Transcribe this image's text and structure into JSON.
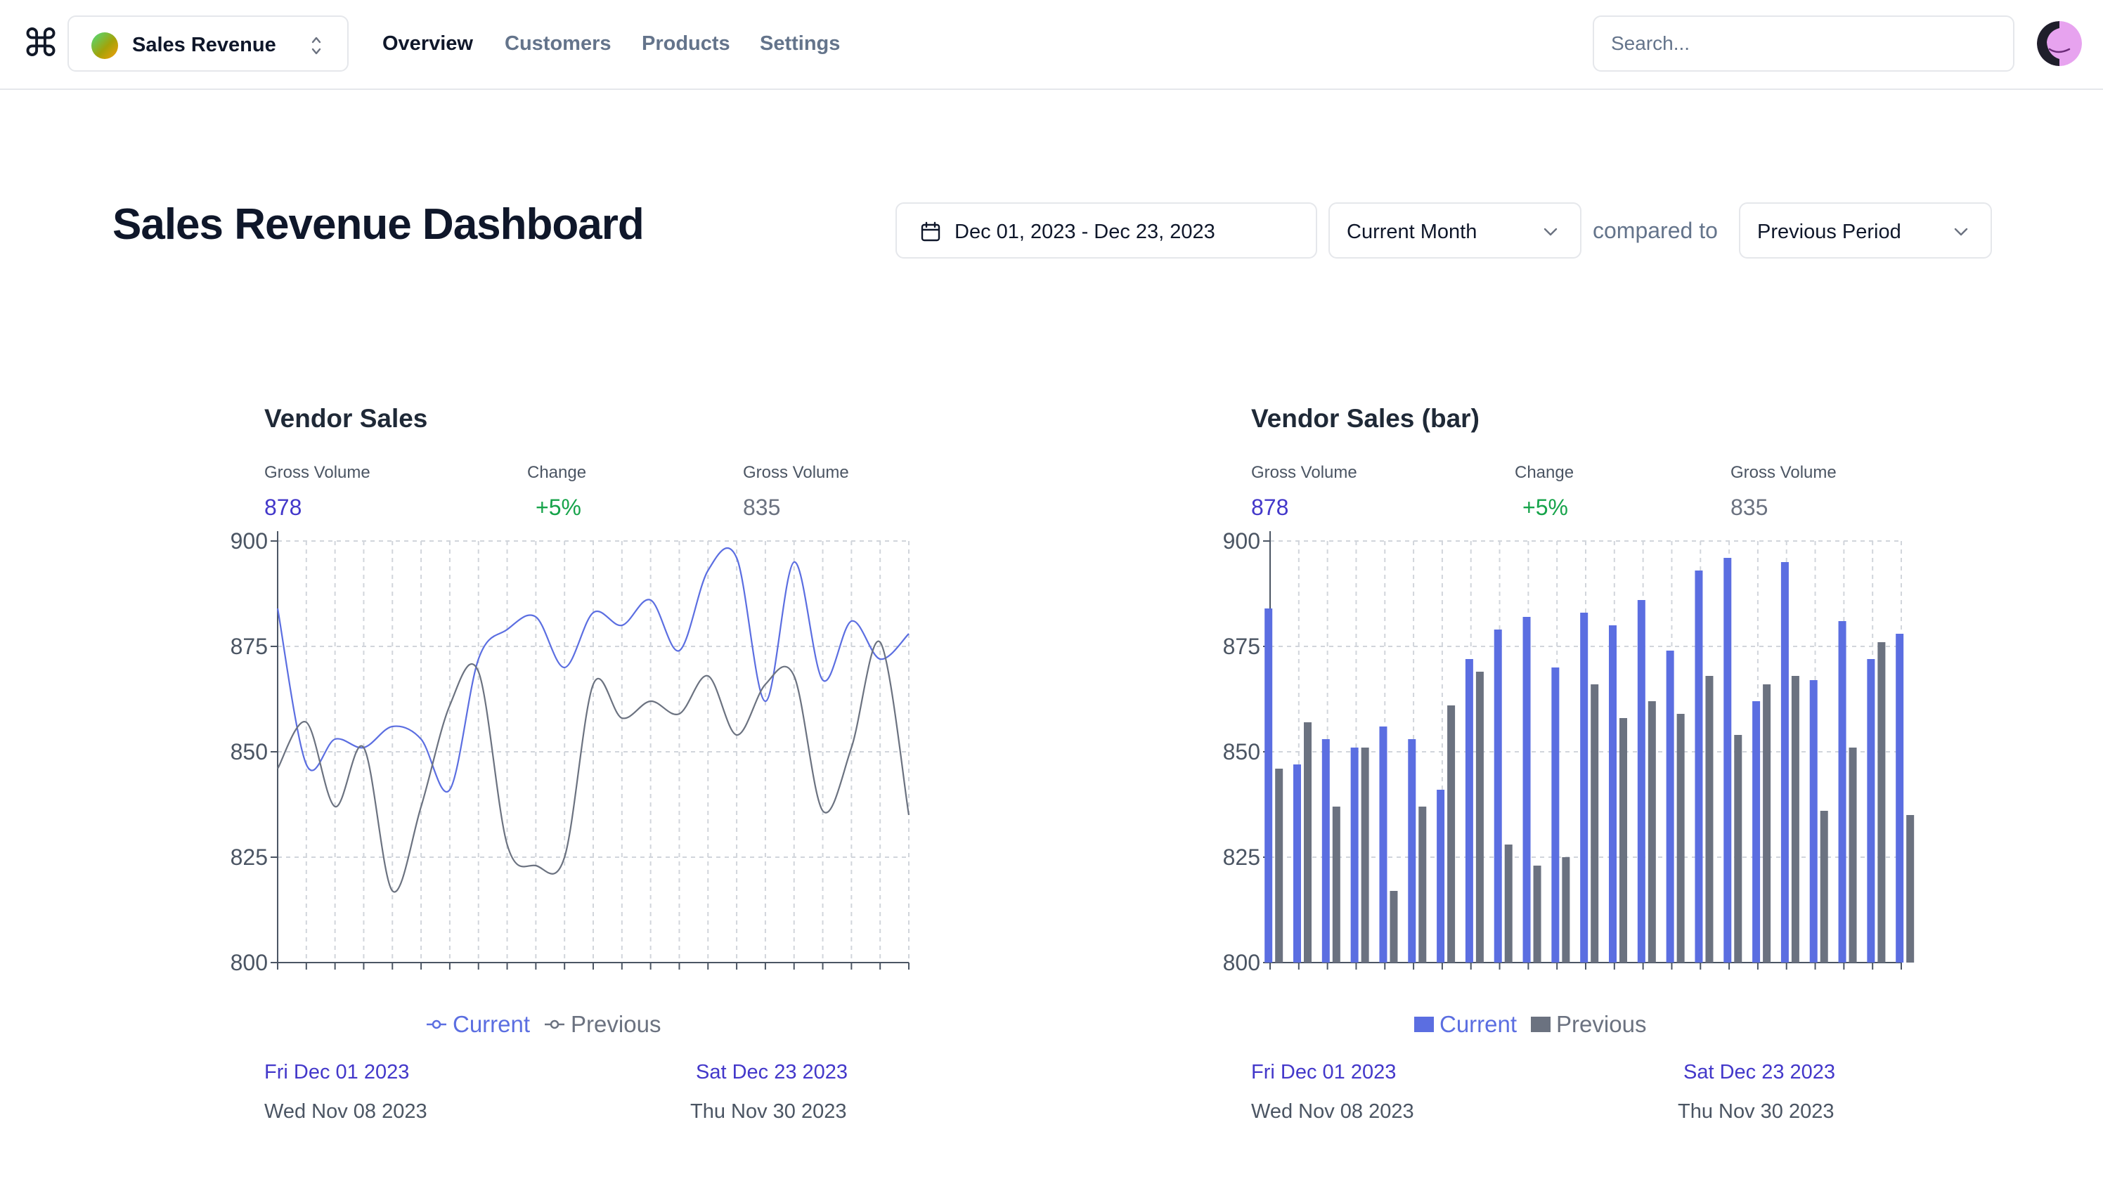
{
  "app": {
    "team_name": "Sales Revenue",
    "search_placeholder": "Search..."
  },
  "nav": [
    {
      "label": "Overview",
      "active": true
    },
    {
      "label": "Customers",
      "active": false
    },
    {
      "label": "Products",
      "active": false
    },
    {
      "label": "Settings",
      "active": false
    }
  ],
  "header": {
    "title": "Sales Revenue Dashboard",
    "date_range": "Dec 01, 2023 - Dec 23, 2023",
    "period_select": "Current Month",
    "compared_to_label": "compared to",
    "comparison_select": "Previous Period"
  },
  "icons": {
    "logo": "command-icon",
    "team_selector": "chevron-up-down-icon",
    "date_picker": "calendar-icon",
    "select": "chevron-down-icon"
  },
  "colors": {
    "current": "#5b6ee1",
    "previous": "#6b7280",
    "change_positive": "#16a34a",
    "accent_text": "#4338ca"
  },
  "cards": [
    {
      "title": "Vendor Sales",
      "kpis": [
        {
          "label": "Gross Volume",
          "value": "878"
        },
        {
          "label": "Change",
          "value": "+5%"
        },
        {
          "label": "Gross Volume",
          "value": "835"
        }
      ],
      "legend": [
        "Current",
        "Previous"
      ],
      "current_range": {
        "start": "Fri Dec 01 2023",
        "end": "Sat Dec 23 2023"
      },
      "previous_range": {
        "start": "Wed Nov 08 2023",
        "end": "Thu Nov 30 2023"
      }
    },
    {
      "title": "Vendor Sales (bar)",
      "kpis": [
        {
          "label": "Gross Volume",
          "value": "878"
        },
        {
          "label": "Change",
          "value": "+5%"
        },
        {
          "label": "Gross Volume",
          "value": "835"
        }
      ],
      "legend": [
        "Current",
        "Previous"
      ],
      "current_range": {
        "start": "Fri Dec 01 2023",
        "end": "Sat Dec 23 2023"
      },
      "previous_range": {
        "start": "Wed Nov 08 2023",
        "end": "Thu Nov 30 2023"
      }
    }
  ],
  "chart_data": [
    {
      "type": "line",
      "title": "Vendor Sales",
      "x_count": 23,
      "ylim": [
        800,
        900
      ],
      "yticks": [
        800,
        825,
        850,
        875,
        900
      ],
      "grid": true,
      "legend_position": "bottom",
      "series": [
        {
          "name": "Current",
          "values": [
            884,
            847,
            853,
            851,
            856,
            853,
            841,
            872,
            879,
            882,
            870,
            883,
            880,
            886,
            874,
            893,
            896,
            862,
            895,
            867,
            881,
            872,
            878
          ]
        },
        {
          "name": "Previous",
          "values": [
            846,
            857,
            837,
            851,
            817,
            837,
            861,
            869,
            828,
            823,
            825,
            866,
            858,
            862,
            859,
            868,
            854,
            866,
            868,
            836,
            851,
            876,
            835
          ]
        }
      ]
    },
    {
      "type": "bar",
      "title": "Vendor Sales (bar)",
      "x_count": 23,
      "ylim": [
        800,
        900
      ],
      "yticks": [
        800,
        825,
        850,
        875,
        900
      ],
      "grid": true,
      "legend_position": "bottom",
      "series": [
        {
          "name": "Current",
          "values": [
            884,
            847,
            853,
            851,
            856,
            853,
            841,
            872,
            879,
            882,
            870,
            883,
            880,
            886,
            874,
            893,
            896,
            862,
            895,
            867,
            881,
            872,
            878
          ]
        },
        {
          "name": "Previous",
          "values": [
            846,
            857,
            837,
            851,
            817,
            837,
            861,
            869,
            828,
            823,
            825,
            866,
            858,
            862,
            859,
            868,
            854,
            866,
            868,
            836,
            851,
            876,
            835
          ]
        }
      ]
    }
  ]
}
